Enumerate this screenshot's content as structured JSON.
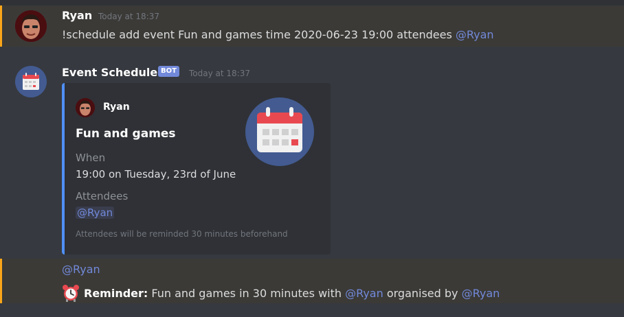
{
  "messages": {
    "m1": {
      "author": "Ryan",
      "timestamp": "Today at 18:37",
      "text": "!schedule add event Fun and games time 2020-06-23 19:00 attendees ",
      "mention": "@Ryan"
    },
    "m2": {
      "author": "Event Scheduler",
      "bot_tag": "BOT",
      "timestamp": "Today at 18:37",
      "embed": {
        "author": "Ryan",
        "title": "Fun and games",
        "when_label": "When",
        "when_value": "19:00 on Tuesday, 23rd of June",
        "attendees_label": "Attendees",
        "attendees_value": "@Ryan",
        "footer": "Attendees will be reminded 30 minutes beforehand",
        "accent_color": "#4f8ff7"
      }
    },
    "m3": {
      "mention_line": "@Ryan",
      "alarm_icon": "alarm-clock-icon",
      "reminder_label": "Reminder:",
      "text1": " Fun and games in 30 minutes with ",
      "mention1": "@Ryan",
      "text2": " organised by ",
      "mention2": "@Ryan"
    }
  },
  "colors": {
    "background": "#36393f",
    "highlight": "#3b3a37",
    "mention": "#7289da",
    "highlight_border": "#faa61a"
  }
}
